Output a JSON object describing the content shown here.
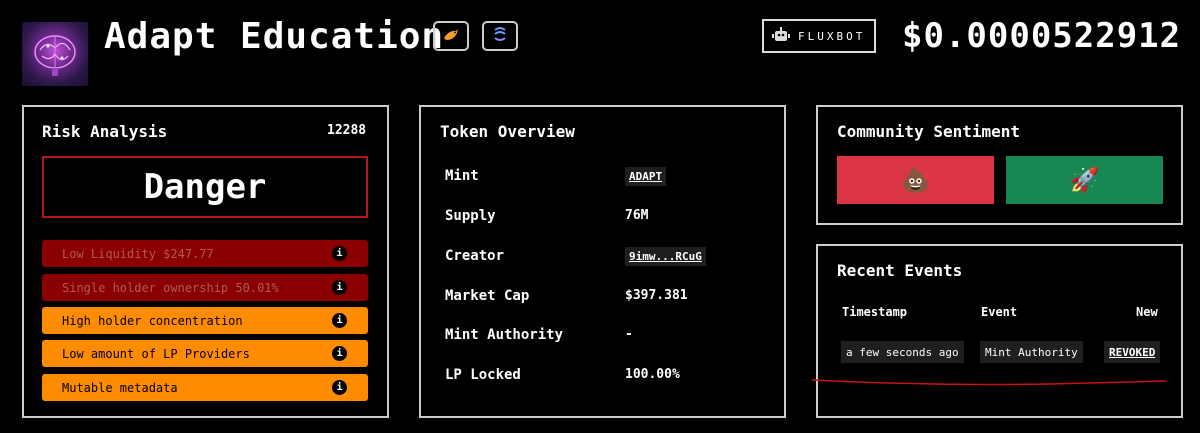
{
  "header": {
    "title": "Adapt Education",
    "fluxbot_label": "FLUXBOT",
    "price": "$0.0000522912"
  },
  "risk": {
    "title": "Risk Analysis",
    "score": "12288",
    "level": "Danger",
    "items": [
      {
        "label": "Low Liquidity $247.77",
        "severity": "high"
      },
      {
        "label": "Single holder ownership 50.01%",
        "severity": "high"
      },
      {
        "label": "High holder concentration",
        "severity": "medium"
      },
      {
        "label": "Low amount of LP Providers",
        "severity": "medium"
      },
      {
        "label": "Mutable metadata",
        "severity": "medium"
      }
    ]
  },
  "overview": {
    "title": "Token Overview",
    "rows": [
      {
        "label": "Mint",
        "value": "ADAPT"
      },
      {
        "label": "Supply",
        "value": "76M"
      },
      {
        "label": "Creator",
        "value": "9imw...RCuG"
      },
      {
        "label": "Market Cap",
        "value": "$397.381"
      },
      {
        "label": "Mint Authority",
        "value": "-"
      },
      {
        "label": "LP Locked",
        "value": "100.00%"
      }
    ]
  },
  "sentiment": {
    "title": "Community Sentiment",
    "down_icon": "poop-emoji",
    "up_icon": "rocket-emoji"
  },
  "events": {
    "title": "Recent Events",
    "columns": [
      "Timestamp",
      "Event",
      "New"
    ],
    "rows": [
      {
        "timestamp": "a few seconds ago",
        "event": "Mint Authority",
        "new": "REVOKED"
      }
    ]
  },
  "colors": {
    "danger_border": "#b3161b",
    "risk_high": "#8a0000",
    "risk_medium": "#ff8c00",
    "sentiment_down": "#dc3545",
    "sentiment_up": "#198754",
    "annotation_line": "#cc1111"
  }
}
